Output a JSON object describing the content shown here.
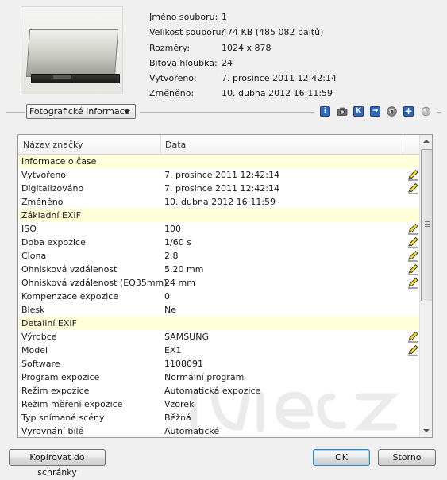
{
  "file_info": [
    {
      "label": "Jméno souboru:",
      "value": "1"
    },
    {
      "label": "Velikost souboru:",
      "value": "474 KB (485 082 bajtů)"
    },
    {
      "label": "Rozměry:",
      "value": "1024 x 878"
    },
    {
      "label": "Bitová hloubka:",
      "value": "24"
    },
    {
      "label": "Vytvořeno:",
      "value": "7. prosince 2011 12:42:14"
    },
    {
      "label": "Změněno:",
      "value": "10. dubna 2012 16:11:59"
    }
  ],
  "dropdown": {
    "selected": "Fotografické informace"
  },
  "toolbar_icons": [
    "info-icon",
    "camera-icon",
    "k-icon",
    "arrow-right-icon",
    "globe-icon",
    "plus-icon",
    "gray-circle-icon"
  ],
  "table": {
    "headers": [
      "Název značky",
      "Data"
    ],
    "rows": [
      {
        "name": "Informace o čase",
        "value": "",
        "group": true,
        "editable": false
      },
      {
        "name": "Vytvořeno",
        "value": "7. prosince 2011 12:42:14",
        "group": false,
        "editable": true
      },
      {
        "name": "Digitalizováno",
        "value": "7. prosince 2011 12:42:14",
        "group": false,
        "editable": true
      },
      {
        "name": "Změněno",
        "value": "10. dubna 2012 16:11:59",
        "group": false,
        "editable": false
      },
      {
        "name": "Základní EXIF",
        "value": "",
        "group": true,
        "editable": false
      },
      {
        "name": "ISO",
        "value": "100",
        "group": false,
        "editable": true
      },
      {
        "name": "Doba expozice",
        "value": "1/60 s",
        "group": false,
        "editable": true
      },
      {
        "name": "Clona",
        "value": "2.8",
        "group": false,
        "editable": true
      },
      {
        "name": "Ohnisková vzdálenost",
        "value": "5.20 mm",
        "group": false,
        "editable": true
      },
      {
        "name": "Ohnisková vzdálenost (EQ35mm)",
        "value": "24 mm",
        "group": false,
        "editable": true
      },
      {
        "name": "Kompenzace expozice",
        "value": "0",
        "group": false,
        "editable": false
      },
      {
        "name": "Blesk",
        "value": "Ne",
        "group": false,
        "editable": false
      },
      {
        "name": "Detailní EXIF",
        "value": "",
        "group": true,
        "editable": false
      },
      {
        "name": "Výrobce",
        "value": "SAMSUNG",
        "group": false,
        "editable": true
      },
      {
        "name": "Model",
        "value": "EX1",
        "group": false,
        "editable": true
      },
      {
        "name": "Software",
        "value": "1108091",
        "group": false,
        "editable": false
      },
      {
        "name": "Program expozice",
        "value": "Normální program",
        "group": false,
        "editable": false
      },
      {
        "name": "Režim expozice",
        "value": "Automatická expozice",
        "group": false,
        "editable": false
      },
      {
        "name": "Režim měření expozice",
        "value": "Vzorek",
        "group": false,
        "editable": false
      },
      {
        "name": "Typ snímané scény",
        "value": "Běžná",
        "group": false,
        "editable": false
      },
      {
        "name": "Vyrovnání bílé",
        "value": "Automatické",
        "group": false,
        "editable": false
      }
    ]
  },
  "buttons": {
    "copy": "Kopírovat do schránky",
    "ok": "OK",
    "cancel": "Storno"
  },
  "watermark": "živě.cz",
  "colors": {
    "group_row_bg": "#ffffd9",
    "toolbar_blue": "#2f66b8",
    "ok_border": "#3c7fb1"
  }
}
